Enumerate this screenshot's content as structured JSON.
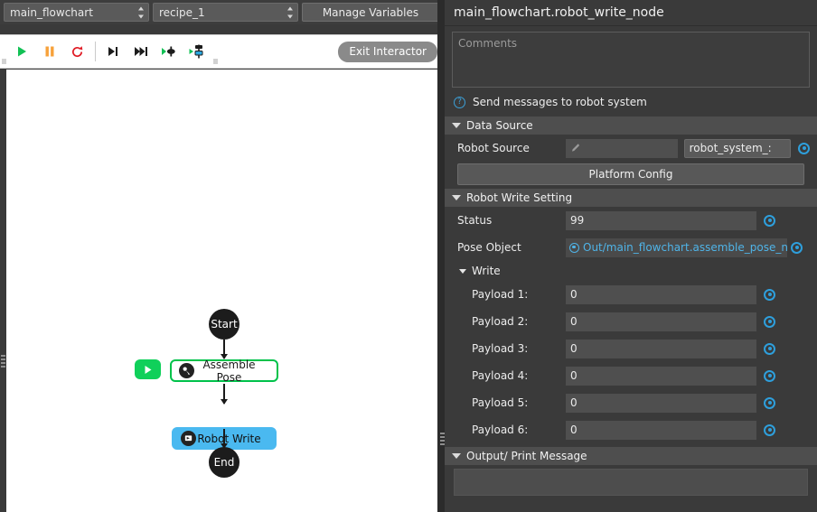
{
  "left": {
    "selectors": {
      "flowchart": {
        "value": "main_flowchart"
      },
      "recipe": {
        "value": "recipe_1"
      },
      "manage_variables_label": "Manage Variables"
    },
    "toolbar": {
      "run_icon": "play-icon",
      "pause_icon": "pause-icon",
      "reset_icon": "reload-icon",
      "step_icon": "step-over-icon",
      "step_fast_icon": "step-forward-icon",
      "run_to_node_icon": "run-to-node-icon",
      "run_to_device_icon": "run-to-device-icon",
      "exit_interactor_label": "Exit Interactor"
    },
    "flowchart": {
      "run_here_icon": "play-node-icon",
      "nodes": [
        {
          "id": "start",
          "label": "Start",
          "type": "terminal"
        },
        {
          "id": "assemble_pose",
          "label": "Assemble Pose",
          "type": "box",
          "state": "selected",
          "icon": "pose-node-icon"
        },
        {
          "id": "robot_write",
          "label": "Robot Write",
          "type": "box",
          "state": "active",
          "icon": "robot-write-node-icon"
        },
        {
          "id": "end",
          "label": "End",
          "type": "terminal"
        }
      ]
    }
  },
  "right": {
    "title": "main_flowchart.robot_write_node",
    "comments_placeholder": "Comments",
    "help_text": "Send messages to robot system",
    "help_icon": "question-icon",
    "sections": {
      "data_source": {
        "title": "Data Source",
        "robot_source_label": "Robot Source",
        "robot_source_value": "",
        "robot_source_icon": "pipette-icon",
        "robot_source_select": "robot_system_:",
        "platform_config_label": "Platform Config"
      },
      "robot_write_setting": {
        "title": "Robot Write Setting",
        "status_label": "Status",
        "status_value": "99",
        "pose_object_label": "Pose Object",
        "pose_object_value": "Out/main_flowchart.assemble_pose_n",
        "write_label": "Write",
        "payloads": [
          {
            "label": "Payload 1:",
            "value": "0"
          },
          {
            "label": "Payload 2:",
            "value": "0"
          },
          {
            "label": "Payload 3:",
            "value": "0"
          },
          {
            "label": "Payload 4:",
            "value": "0"
          },
          {
            "label": "Payload 5:",
            "value": "0"
          },
          {
            "label": "Payload 6:",
            "value": "0"
          }
        ]
      },
      "output_print_message": {
        "title": "Output/ Print Message",
        "value": ""
      }
    }
  },
  "colors": {
    "accent_blue": "#2e9fdc",
    "link_blue": "#4fb4e8",
    "node_green": "#00c24a",
    "node_blue": "#4ab9f0",
    "run_green": "#10d05a",
    "panel_bg": "#3a3a3a",
    "section_bg": "#4e4e4e"
  }
}
